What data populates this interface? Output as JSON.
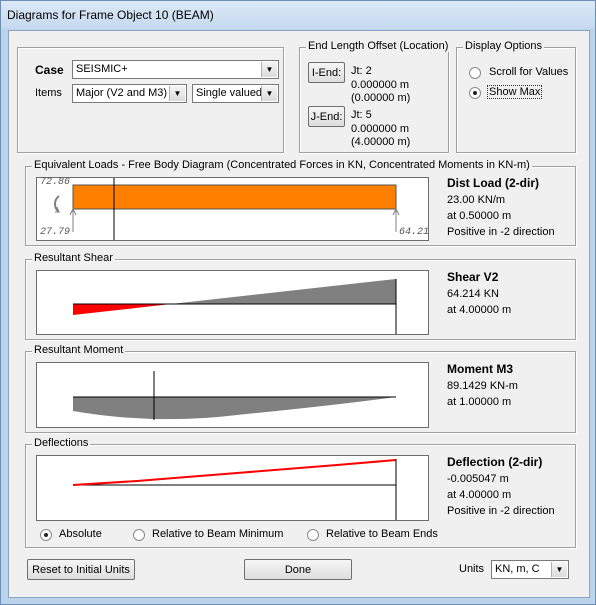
{
  "window": {
    "title": "Diagrams for Frame Object 10  (BEAM)"
  },
  "case": {
    "label": "Case",
    "value": "SEISMIC+"
  },
  "items": {
    "label": "Items",
    "component": "Major (V2 and M3)",
    "valued": "Single valued"
  },
  "offset": {
    "caption": "End Length Offset (Location)",
    "i_end": {
      "button": "I-End:",
      "jt": "Jt:  2",
      "value": "0.000000 m",
      "location": "(0.00000 m)"
    },
    "j_end": {
      "button": "J-End:",
      "jt": "Jt:  5",
      "value": "0.000000 m",
      "location": "(4.00000 m)"
    }
  },
  "display": {
    "caption": "Display Options",
    "options": [
      {
        "label": "Scroll for Values",
        "selected": false
      },
      {
        "label": "Show Max",
        "selected": true
      }
    ]
  },
  "loads": {
    "caption": "Equivalent Loads - Free Body Diagram  (Concentrated Forces in KN, Concentrated Moments in KN-m)",
    "moment_left": "72.86",
    "force_left": "27.79",
    "force_right": "64.21",
    "title": "Dist Load (2-dir)",
    "value": "23.00 KN/m",
    "location": "at 0.50000 m",
    "direction": "Positive in -2 direction",
    "load_color": "#ff8000"
  },
  "shear": {
    "caption": "Resultant Shear",
    "title": "Shear V2",
    "value": "64.214 KN",
    "location": "at 4.00000 m",
    "neg_color": "#ff0000",
    "pos_color": "#808080"
  },
  "moment": {
    "caption": "Resultant Moment",
    "title": "Moment M3",
    "value": "89.1429 KN-m",
    "location": "at 1.00000 m",
    "color": "#808080"
  },
  "deflection": {
    "caption": "Deflections",
    "title": "Deflection (2-dir)",
    "value": "-0.005047 m",
    "location": "at 4.00000 m",
    "direction": "Positive in -2 direction",
    "line_color": "#ff0000",
    "modes": [
      {
        "label": "Absolute",
        "selected": true
      },
      {
        "label": "Relative to Beam Minimum",
        "selected": false
      },
      {
        "label": "Relative to Beam Ends",
        "selected": false
      }
    ]
  },
  "footer": {
    "reset_label": "Reset to Initial Units",
    "done_label": "Done",
    "units_label": "Units",
    "units_value": "KN, m, C"
  }
}
